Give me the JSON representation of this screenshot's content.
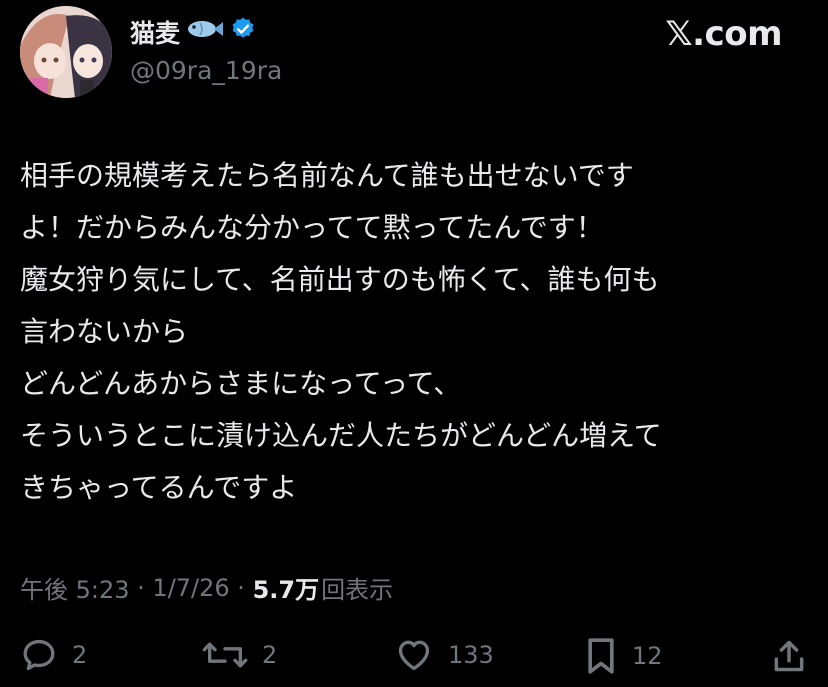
{
  "author": {
    "display_name": "猫麦",
    "emoji": "fish-emoji",
    "verified": true,
    "handle": "@09ra_19ra"
  },
  "brand": "𝕏.com",
  "tweet": {
    "lines": [
      "相手の規模考えたら名前なんて誰も出せないです",
      "よ！だからみんな分かってて黙ってたんです！",
      "魔女狩り気にして、名前出すのも怖くて、誰も何も",
      "言わないから",
      "どんどんあからさまになってって、",
      "そういうとこに漬け込んだ人たちがどんどん増えて",
      "きちゃってるんですよ"
    ]
  },
  "meta": {
    "time": "午後 5:23",
    "sep1": " · ",
    "date": "1/7/26",
    "sep2": " · ",
    "views_count": "5.7万",
    "views_label": "回表示"
  },
  "actions": {
    "replies": "2",
    "reposts": "2",
    "likes": "133",
    "bookmarks": "12"
  },
  "colors": {
    "background": "#000000",
    "text": "#e7e9ea",
    "muted": "#71767b",
    "verified": "#1d9bf0"
  }
}
